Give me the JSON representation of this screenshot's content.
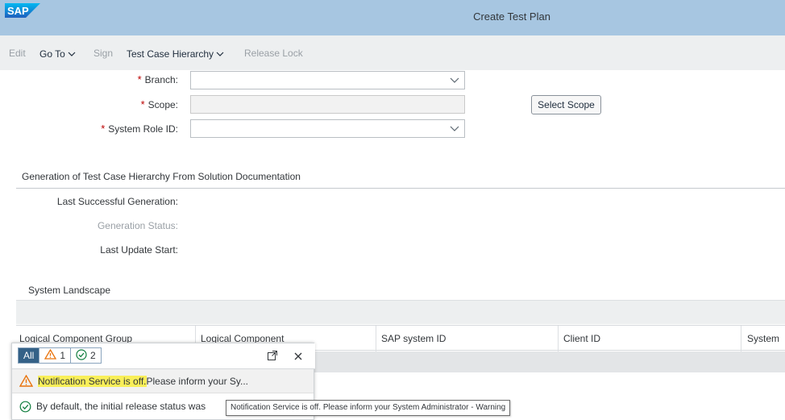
{
  "shell": {
    "logo_text": "SAP",
    "title": "Create Test Plan"
  },
  "toolbar": {
    "edit": "Edit",
    "goto": "Go To",
    "sign": "Sign",
    "hierarchy": "Test Case Hierarchy",
    "release_lock": "Release Lock"
  },
  "form": {
    "required_mark": "*",
    "branch_label": "Branch:",
    "branch_value": "",
    "scope_label": "Scope:",
    "scope_value": "",
    "system_role_label": "System Role ID:",
    "system_role_value": "",
    "select_scope_button": "Select Scope"
  },
  "generation": {
    "title": "Generation of Test Case Hierarchy From Solution Documentation",
    "last_successful": "Last Successful Generation:",
    "status": "Generation Status:",
    "last_update_start": "Last Update Start:"
  },
  "landscape": {
    "title": "System Landscape",
    "columns": [
      "Logical Component Group",
      "Logical Component",
      "SAP system ID",
      "Client ID",
      "System"
    ]
  },
  "notifications": {
    "tab_all": "All",
    "warning_count": "1",
    "success_count": "2",
    "items": [
      {
        "type": "warning",
        "highlight": "Notification Service is off.",
        "text": " Please inform your Sy..."
      },
      {
        "type": "success",
        "text": "By default, the initial release status was"
      }
    ],
    "tooltip": "Notification Service is off. Please inform your System Administrator - Warning"
  },
  "colors": {
    "shell_bg": "#a7c6e1",
    "toolbar_bg": "#edeff0",
    "required": "#bb0000",
    "warning": "#e9730c",
    "success": "#107e3e",
    "active_tab": "#346187",
    "highlight": "#f9ef59"
  },
  "icons": {
    "dropdown": "chevron-down-icon",
    "warning": "warning-triangle-icon",
    "success": "check-circle-icon",
    "popout": "popout-icon",
    "close": "close-icon"
  }
}
